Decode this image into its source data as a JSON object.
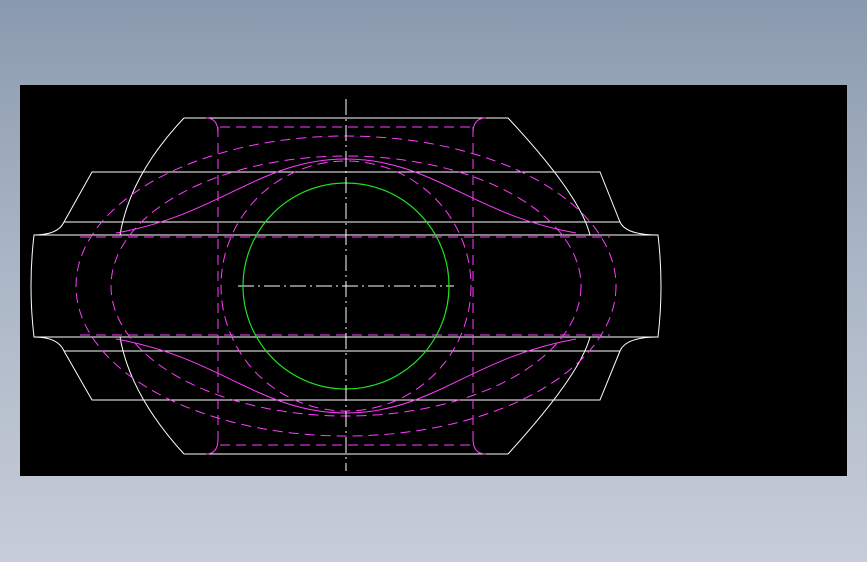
{
  "drawing": {
    "background_color": "#000000",
    "window_background": "#8a9aae",
    "line_colors": {
      "outline": "#ffffff",
      "hidden": "#ff3cff",
      "bore": "#1fe01f",
      "centerline": "#ffffff"
    }
  }
}
